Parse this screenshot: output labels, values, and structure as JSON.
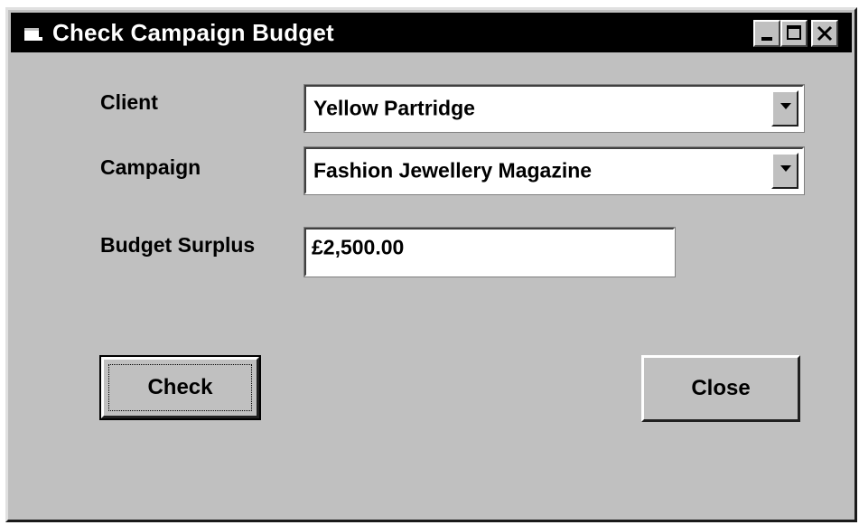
{
  "window": {
    "title": "Check Campaign Budget",
    "icon": "form-icon",
    "controls": {
      "minimize_icon": "minimize-icon",
      "maximize_icon": "maximize-icon",
      "close_icon": "close-icon"
    }
  },
  "form": {
    "client_label": "Client",
    "client_value": "Yellow Partridge",
    "campaign_label": "Campaign",
    "campaign_value": "Fashion Jewellery Magazine",
    "budget_label": "Budget Surplus",
    "budget_value": "£2,500.00"
  },
  "buttons": {
    "check_label": "Check",
    "close_label": "Close"
  },
  "colors": {
    "window_face": "#c0c0c0",
    "titlebar": "#000000",
    "field_background": "#ffffff"
  }
}
